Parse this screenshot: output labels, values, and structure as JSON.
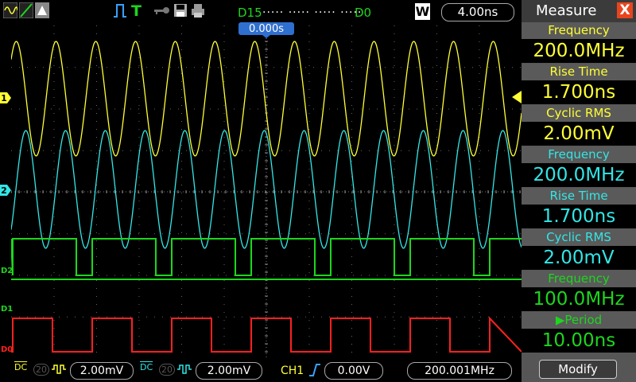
{
  "colors": {
    "ch1": "#ffff33",
    "ch2": "#33e6e6",
    "digital": "#1dd61d",
    "d1": "#ff2020",
    "accent": "#e8451e",
    "panel": "#565656"
  },
  "toolbar": {
    "icons": [
      "wave-display-icon",
      "ramp-icon",
      "persistence-icon",
      "run-pulse-icon",
      "trigger-T-icon",
      "key-icon",
      "save-icon",
      "print-icon"
    ],
    "trigger_label": "T",
    "logic_start": "D15",
    "logic_end": "D0",
    "logic_dots": "····· ····· ····· ·····",
    "window_badge": "W",
    "timebase": "4.00ns"
  },
  "screen": {
    "trigger_offset": "0.000s",
    "ch1_marker": "1",
    "ch2_marker": "2",
    "d2_label": "D2",
    "d1_label": "D1",
    "d0_label": "D0"
  },
  "bottom": {
    "ch1_coupling": "DC",
    "ch1_bw": "20",
    "ch1_scale": "2.00mV",
    "ch2_coupling": "DC",
    "ch2_bw": "20",
    "ch2_scale": "2.00mV",
    "trigger_source": "CH1",
    "trigger_level": "0.00V",
    "trigger_freq": "200.001MHz"
  },
  "measure": {
    "title": "Measure",
    "close": "X",
    "items": [
      {
        "label": "Frequency",
        "value": "200.0MHz",
        "color": "#ffff33"
      },
      {
        "label": "Rise Time",
        "value": "1.700ns",
        "color": "#ffff33"
      },
      {
        "label": "Cyclic RMS",
        "value": "2.00mV",
        "color": "#ffff33"
      },
      {
        "label": "Frequency",
        "value": "200.0MHz",
        "color": "#33e6e6"
      },
      {
        "label": "Rise Time",
        "value": "1.700ns",
        "color": "#33e6e6"
      },
      {
        "label": "Cyclic RMS",
        "value": "2.00mV",
        "color": "#33e6e6"
      },
      {
        "label": "Frequency",
        "value": "100.0MHz",
        "color": "#1dd61d"
      },
      {
        "label": "▶Period",
        "value": "10.00ns",
        "color": "#1dd61d"
      }
    ],
    "modify": "Modify"
  }
}
